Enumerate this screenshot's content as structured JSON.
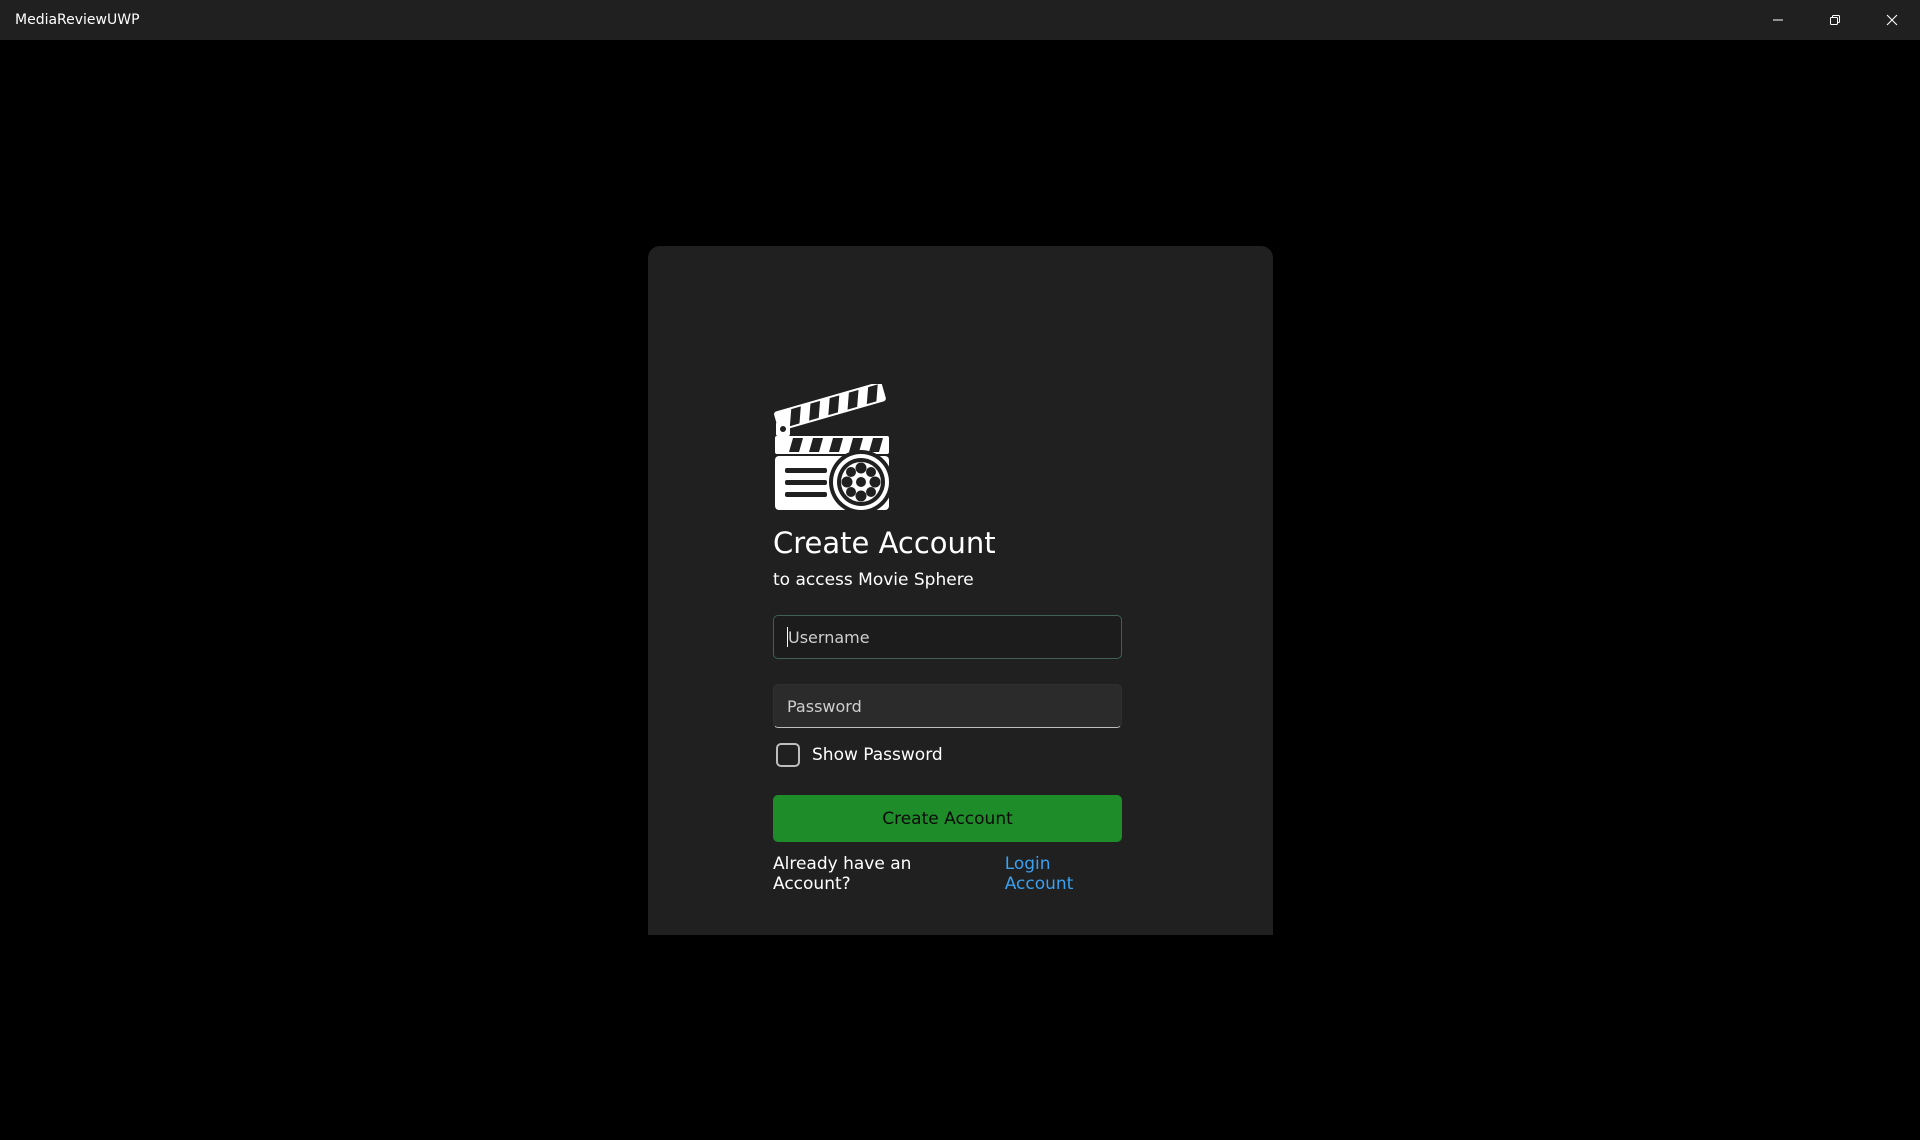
{
  "window": {
    "title": "MediaReviewUWP",
    "controls": {
      "minimize_icon": "minimize-icon",
      "restore_icon": "restore-icon",
      "close_icon": "close-icon"
    }
  },
  "card": {
    "logo_icon": "clapperboard-film-reel-icon",
    "heading": "Create Account",
    "subheading": "to access Movie Sphere",
    "username": {
      "placeholder": "Username",
      "value": ""
    },
    "password": {
      "placeholder": "Password",
      "value": ""
    },
    "show_password_label": "Show Password",
    "show_password_checked": false,
    "create_button_label": "Create Account",
    "footer_text": "Already have an Account?",
    "login_link_label": "Login Account"
  },
  "colors": {
    "accent_button": "#1f8c2a",
    "link": "#3aa0f0",
    "card_background": "#202020",
    "page_background": "#000000"
  }
}
